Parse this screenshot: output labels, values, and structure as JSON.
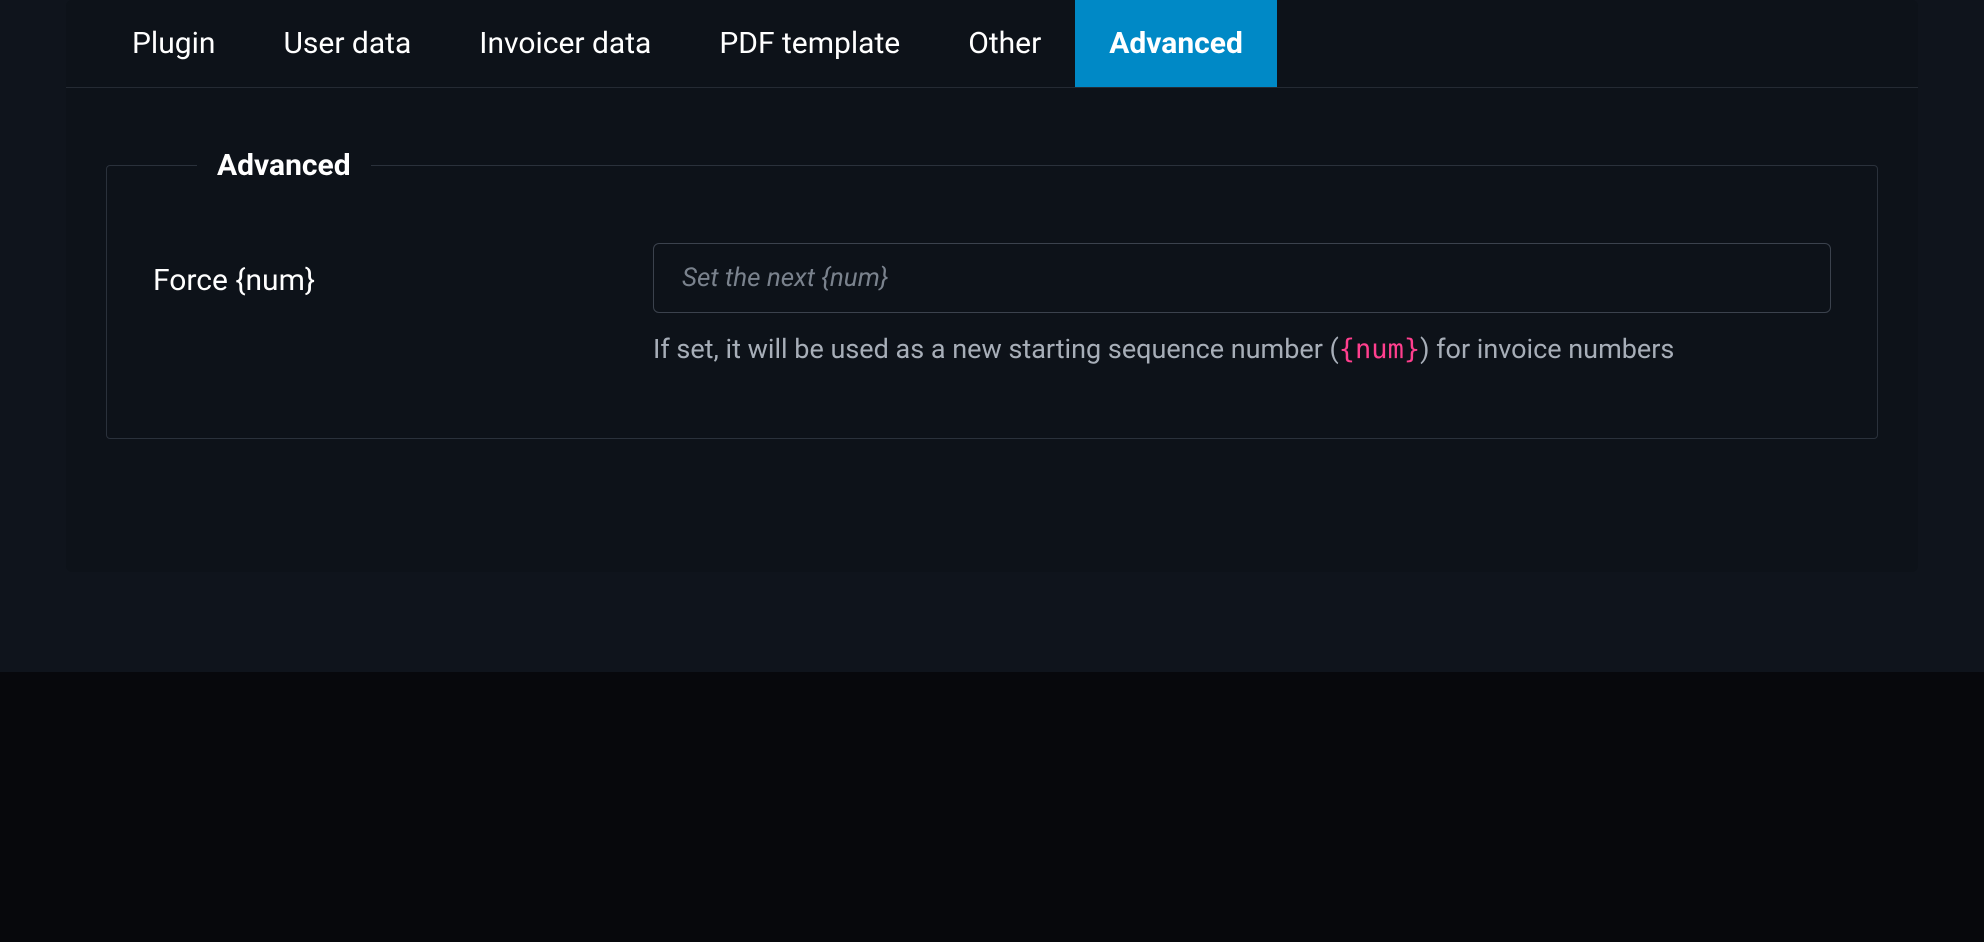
{
  "tabs": [
    {
      "label": "Plugin",
      "active": false
    },
    {
      "label": "User data",
      "active": false
    },
    {
      "label": "Invoicer data",
      "active": false
    },
    {
      "label": "PDF template",
      "active": false
    },
    {
      "label": "Other",
      "active": false
    },
    {
      "label": "Advanced",
      "active": true
    }
  ],
  "section": {
    "legend": "Advanced",
    "field": {
      "label": "Force {num}",
      "placeholder": "Set the next {num}",
      "value": "",
      "help_pre": "If set, it will be used as a new starting sequence number (",
      "help_code": "{num}",
      "help_post": ") for invoice numbers"
    }
  }
}
